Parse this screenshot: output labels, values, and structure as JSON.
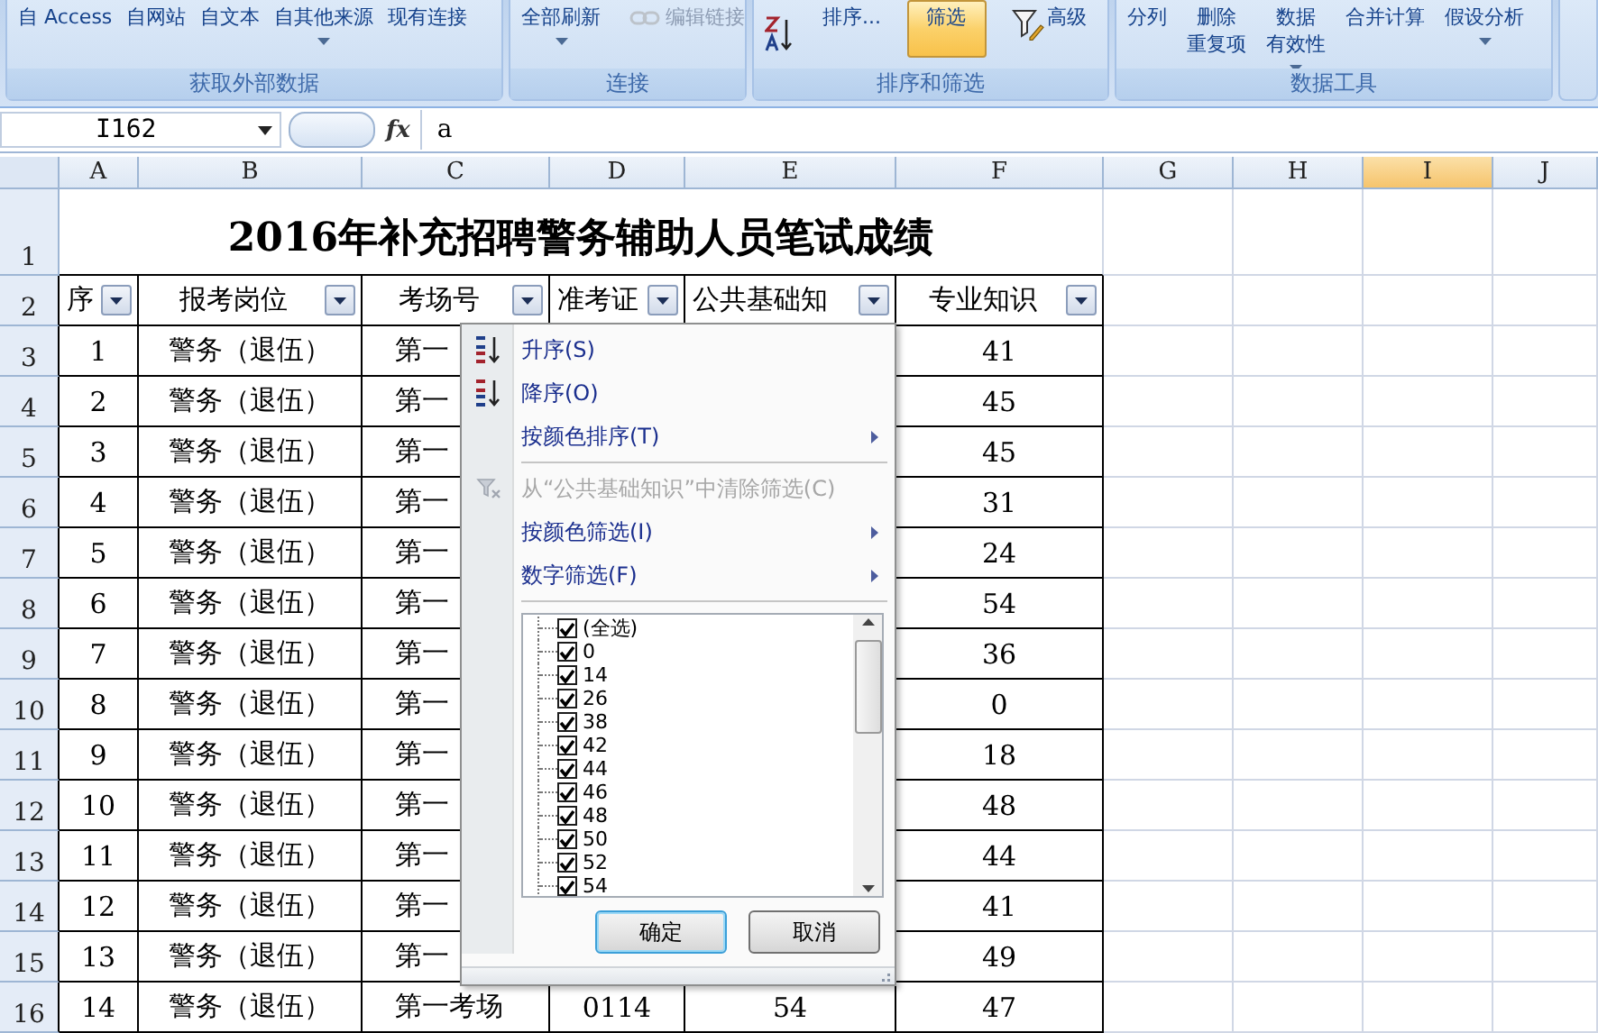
{
  "ribbon": {
    "groups": [
      {
        "label": "获取外部数据",
        "commands": [
          {
            "lines": [
              "自 Access"
            ],
            "kind": "plain",
            "dropdown": false,
            "disabled": false,
            "selected": false
          },
          {
            "lines": [
              "自网站"
            ],
            "kind": "plain",
            "dropdown": false,
            "disabled": false,
            "selected": false
          },
          {
            "lines": [
              "自文本"
            ],
            "kind": "plain",
            "dropdown": false,
            "disabled": false,
            "selected": false
          },
          {
            "lines": [
              "自其他来源"
            ],
            "kind": "plain",
            "dropdown": true,
            "disabled": false,
            "selected": false
          },
          {
            "lines": [
              "现有连接"
            ],
            "kind": "plain",
            "dropdown": false,
            "disabled": false,
            "selected": false
          }
        ]
      },
      {
        "label": "连接",
        "commands": [
          {
            "lines": [
              "全部刷新"
            ],
            "kind": "plain",
            "dropdown": true,
            "disabled": false,
            "selected": false
          },
          {
            "lines": [
              "编辑链接"
            ],
            "kind": "link",
            "dropdown": false,
            "disabled": true,
            "selected": false
          }
        ]
      },
      {
        "label": "排序和筛选",
        "commands": [
          {
            "kind": "sort",
            "dropdown": false,
            "disabled": false,
            "selected": false
          },
          {
            "lines": [
              "排序..."
            ],
            "kind": "plain",
            "dropdown": false,
            "disabled": false,
            "selected": false
          },
          {
            "lines": [
              "筛选"
            ],
            "kind": "plain",
            "dropdown": false,
            "disabled": false,
            "selected": true
          },
          {
            "lines": [
              "高级"
            ],
            "kind": "advanced",
            "dropdown": false,
            "disabled": false,
            "selected": false
          }
        ]
      },
      {
        "label": "数据工具",
        "commands": [
          {
            "lines": [
              "分列"
            ],
            "kind": "plain",
            "dropdown": false,
            "disabled": false,
            "selected": false
          },
          {
            "lines": [
              "删除",
              "重复项"
            ],
            "kind": "plain",
            "dropdown": false,
            "disabled": false,
            "selected": false
          },
          {
            "lines": [
              "数据",
              "有效性"
            ],
            "kind": "plain",
            "dropdown": true,
            "disabled": false,
            "selected": false
          },
          {
            "lines": [
              "合并计算"
            ],
            "kind": "plain",
            "dropdown": false,
            "disabled": false,
            "selected": false
          },
          {
            "lines": [
              "假设分析"
            ],
            "kind": "plain",
            "dropdown": true,
            "disabled": false,
            "selected": false
          }
        ]
      }
    ]
  },
  "formula_bar": {
    "name_box": "I162",
    "function_label": "fx",
    "value": "a"
  },
  "sheet": {
    "columns": [
      {
        "label": "A",
        "selected": false
      },
      {
        "label": "B",
        "selected": false
      },
      {
        "label": "C",
        "selected": false
      },
      {
        "label": "D",
        "selected": false
      },
      {
        "label": "E",
        "selected": false
      },
      {
        "label": "F",
        "selected": false
      },
      {
        "label": "G",
        "selected": false
      },
      {
        "label": "H",
        "selected": false
      },
      {
        "label": "I",
        "selected": true
      },
      {
        "label": "J",
        "selected": false
      }
    ],
    "title_row": {
      "number": "1",
      "title": "2016年补充招聘警务辅助人员笔试成绩"
    },
    "header_row": {
      "number": "2",
      "headers": [
        "序",
        "报考岗位",
        "考场号",
        "准考证",
        "公共基础知",
        "专业知识"
      ]
    },
    "rows": [
      {
        "number": "3",
        "seq": "1",
        "post": "警务（退伍）",
        "room": "第一",
        "professional": "41"
      },
      {
        "number": "4",
        "seq": "2",
        "post": "警务（退伍）",
        "room": "第一",
        "professional": "45"
      },
      {
        "number": "5",
        "seq": "3",
        "post": "警务（退伍）",
        "room": "第一",
        "professional": "45"
      },
      {
        "number": "6",
        "seq": "4",
        "post": "警务（退伍）",
        "room": "第一",
        "professional": "31"
      },
      {
        "number": "7",
        "seq": "5",
        "post": "警务（退伍）",
        "room": "第一",
        "professional": "24"
      },
      {
        "number": "8",
        "seq": "6",
        "post": "警务（退伍）",
        "room": "第一",
        "professional": "54"
      },
      {
        "number": "9",
        "seq": "7",
        "post": "警务（退伍）",
        "room": "第一",
        "professional": "36"
      },
      {
        "number": "10",
        "seq": "8",
        "post": "警务（退伍）",
        "room": "第一",
        "professional": "0"
      },
      {
        "number": "11",
        "seq": "9",
        "post": "警务（退伍）",
        "room": "第一",
        "professional": "18"
      },
      {
        "number": "12",
        "seq": "10",
        "post": "警务（退伍）",
        "room": "第一",
        "professional": "48"
      },
      {
        "number": "13",
        "seq": "11",
        "post": "警务（退伍）",
        "room": "第一",
        "professional": "44"
      },
      {
        "number": "14",
        "seq": "12",
        "post": "警务（退伍）",
        "room": "第一",
        "professional": "41"
      },
      {
        "number": "15",
        "seq": "13",
        "post": "警务（退伍）",
        "room": "第一",
        "professional": "49"
      },
      {
        "number": "16",
        "seq": "14",
        "post": "警务（退伍）",
        "room": "第一考场",
        "ticket": "0114",
        "public_score": "54",
        "professional": "47"
      }
    ]
  },
  "filter_menu": {
    "sections": [
      [
        {
          "label": "升序(S)",
          "kind": "sort_ascending",
          "disabled": false,
          "submenu": false
        },
        {
          "label": "降序(O)",
          "kind": "sort_descending",
          "disabled": false,
          "submenu": false
        },
        {
          "label": "按颜色排序(T)",
          "kind": "plain",
          "disabled": false,
          "submenu": true
        }
      ],
      [
        {
          "label": "从“公共基础知识”中清除筛选(C)",
          "kind": "clear_filter",
          "disabled": true,
          "submenu": false
        },
        {
          "label": "按颜色筛选(I)",
          "kind": "plain",
          "disabled": false,
          "submenu": true
        },
        {
          "label": "数字筛选(F)",
          "kind": "plain",
          "disabled": false,
          "submenu": true
        }
      ]
    ],
    "values": [
      {
        "label": "(全选)",
        "checked": true
      },
      {
        "label": "0",
        "checked": true
      },
      {
        "label": "14",
        "checked": true
      },
      {
        "label": "26",
        "checked": true
      },
      {
        "label": "38",
        "checked": true
      },
      {
        "label": "42",
        "checked": true
      },
      {
        "label": "44",
        "checked": true
      },
      {
        "label": "46",
        "checked": true
      },
      {
        "label": "48",
        "checked": true
      },
      {
        "label": "50",
        "checked": true
      },
      {
        "label": "52",
        "checked": true
      },
      {
        "label": "54",
        "checked": true
      }
    ],
    "buttons": [
      {
        "label": "确定",
        "focused": true
      },
      {
        "label": "取消",
        "focused": false
      }
    ]
  }
}
